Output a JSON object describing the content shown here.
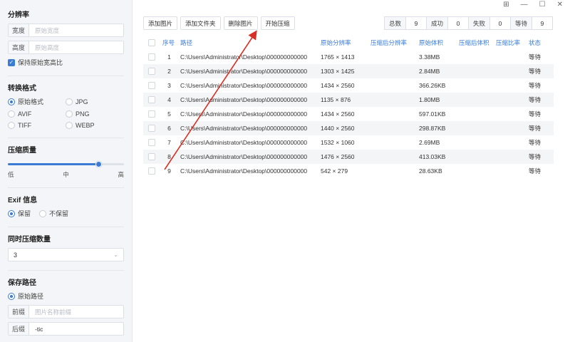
{
  "sidebar": {
    "resolution": {
      "title": "分辨率",
      "width_label": "宽度",
      "width_placeholder": "原始宽度",
      "height_label": "高度",
      "height_placeholder": "原始高度",
      "keep_ratio_label": "保持原始宽高比"
    },
    "format": {
      "title": "转换格式",
      "options": [
        "原始格式",
        "JPG",
        "AVIF",
        "PNG",
        "TIFF",
        "WEBP"
      ],
      "selected": "原始格式"
    },
    "quality": {
      "title": "压缩质量",
      "value_fraction": 0.78,
      "low": "低",
      "mid": "中",
      "high": "高"
    },
    "exif": {
      "title": "Exif 信息",
      "keep": "保留",
      "discard": "不保留",
      "selected": "保留"
    },
    "concurrency": {
      "title": "同时压缩数量",
      "value": "3"
    },
    "save_path": {
      "title": "保存路径",
      "original_path": "原始路径",
      "prefix_label": "前缀",
      "prefix_placeholder": "图片名称前缀",
      "suffix_label": "后缀",
      "suffix_value": "-tic"
    }
  },
  "toolbar": {
    "add_image": "添加图片",
    "add_folder": "添加文件夹",
    "delete_image": "删除图片",
    "start_compress": "开始压缩"
  },
  "stats": {
    "total_label": "总数",
    "total": "9",
    "success_label": "成功",
    "success": "0",
    "fail_label": "失败",
    "fail": "0",
    "wait_label": "等待",
    "wait": "9"
  },
  "table": {
    "headers": {
      "index": "序号",
      "path": "路径",
      "orig_res": "原始分辨率",
      "comp_res": "压缩后分辨率",
      "orig_size": "原始体积",
      "comp_size": "压缩后体积",
      "ratio": "压缩比率",
      "status": "状态"
    },
    "rows": [
      {
        "index": "1",
        "path": "C:\\Users\\Administrator\\Desktop\\000000000000",
        "orig_res": "1765 × 1413",
        "orig_size": "3.38MB",
        "status": "等待"
      },
      {
        "index": "2",
        "path": "C:\\Users\\Administrator\\Desktop\\000000000000",
        "orig_res": "1303 × 1425",
        "orig_size": "2.84MB",
        "status": "等待"
      },
      {
        "index": "3",
        "path": "C:\\Users\\Administrator\\Desktop\\000000000000",
        "orig_res": "1434 × 2560",
        "orig_size": "366.26KB",
        "status": "等待"
      },
      {
        "index": "4",
        "path": "C:\\Users\\Administrator\\Desktop\\000000000000",
        "orig_res": "1135 × 876",
        "orig_size": "1.80MB",
        "status": "等待"
      },
      {
        "index": "5",
        "path": "C:\\Users\\Administrator\\Desktop\\000000000000",
        "orig_res": "1434 × 2560",
        "orig_size": "597.01KB",
        "status": "等待"
      },
      {
        "index": "6",
        "path": "C:\\Users\\Administrator\\Desktop\\000000000000",
        "orig_res": "1440 × 2560",
        "orig_size": "298.87KB",
        "status": "等待"
      },
      {
        "index": "7",
        "path": "C:\\Users\\Administrator\\Desktop\\000000000000",
        "orig_res": "1532 × 1060",
        "orig_size": "2.69MB",
        "status": "等待"
      },
      {
        "index": "8",
        "path": "C:\\Users\\Administrator\\Desktop\\000000000000",
        "orig_res": "1476 × 2560",
        "orig_size": "413.03KB",
        "status": "等待"
      },
      {
        "index": "9",
        "path": "C:\\Users\\Administrator\\Desktop\\000000000000",
        "orig_res": "542 × 279",
        "orig_size": "28.63KB",
        "status": "等待"
      }
    ]
  },
  "window": {
    "grid_icon": "grid-icon",
    "minimize_icon": "minimize-icon",
    "maximize_icon": "maximize-icon",
    "close_icon": "close-icon"
  },
  "colors": {
    "accent": "#3a7bd5",
    "annotation": "#d93025"
  }
}
